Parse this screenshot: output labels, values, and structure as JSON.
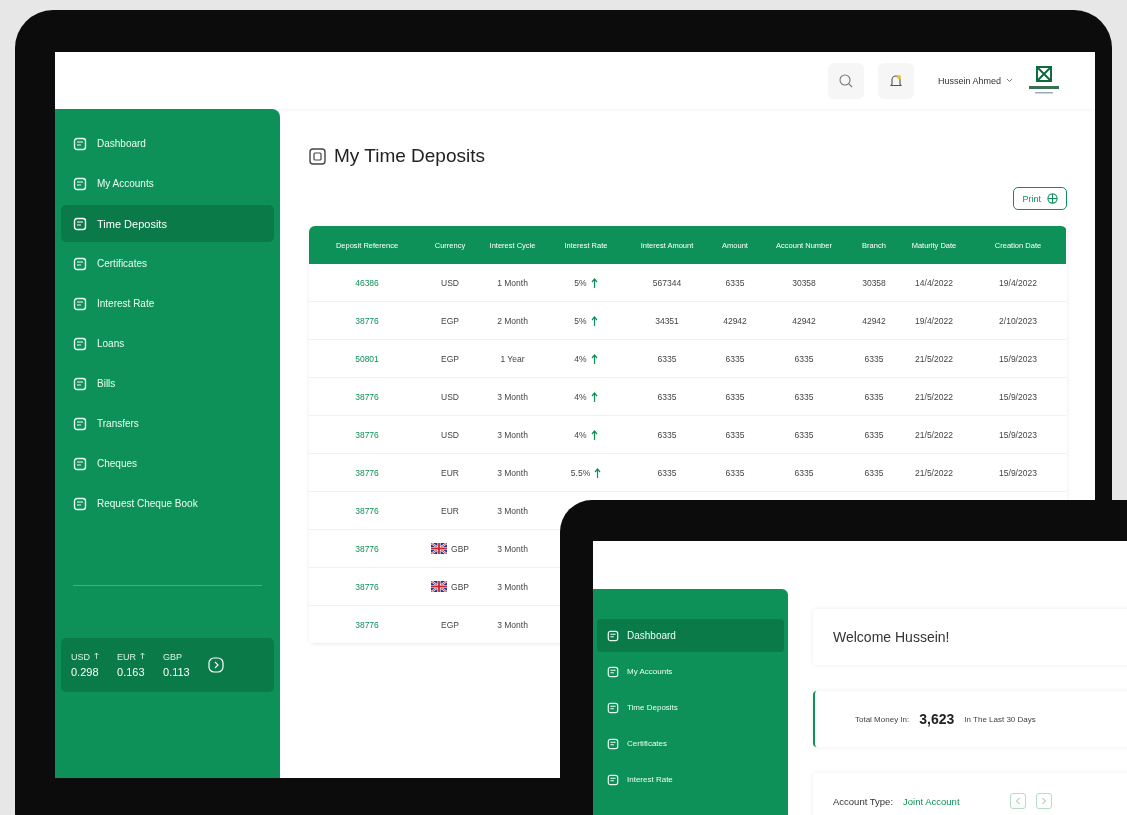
{
  "header": {
    "user_name": "Hussein Ahmed"
  },
  "sidebar": {
    "items": [
      {
        "label": "Dashboard",
        "selected": false
      },
      {
        "label": "My Accounts",
        "selected": false
      },
      {
        "label": "Time Deposits",
        "selected": true
      },
      {
        "label": "Certificates",
        "selected": false
      },
      {
        "label": "Interest Rate",
        "selected": false
      },
      {
        "label": "Loans",
        "selected": false
      },
      {
        "label": "Bills",
        "selected": false
      },
      {
        "label": "Transfers",
        "selected": false
      },
      {
        "label": "Cheques",
        "selected": false
      },
      {
        "label": "Request Cheque Book",
        "selected": false
      }
    ],
    "rates": [
      {
        "currency": "USD",
        "up": true,
        "value": "0.298"
      },
      {
        "currency": "EUR",
        "up": true,
        "value": "0.163"
      },
      {
        "currency": "GBP",
        "up": false,
        "value": "0.113"
      }
    ]
  },
  "page": {
    "title": "My Time Deposits",
    "print_button": "Print"
  },
  "table": {
    "columns": [
      "Deposit Reference",
      "Currency",
      "Interest Cycle",
      "Interest Rate",
      "Interest Amount",
      "Amount",
      "Account Number",
      "Branch",
      "Maturity Date",
      "Creation Date"
    ],
    "rows": [
      {
        "flag": false,
        "cells": [
          "46386",
          "USD",
          "1 Month",
          "5%",
          "567344",
          "6335",
          "30358",
          "30358",
          "14/4/2022",
          "19/4/2022"
        ]
      },
      {
        "flag": false,
        "cells": [
          "38776",
          "EGP",
          "2 Month",
          "5%",
          "34351",
          "42942",
          "42942",
          "42942",
          "19/4/2022",
          "2/10/2023"
        ]
      },
      {
        "flag": false,
        "cells": [
          "50801",
          "EGP",
          "1 Year",
          "4%",
          "6335",
          "6335",
          "6335",
          "6335",
          "21/5/2022",
          "15/9/2023"
        ]
      },
      {
        "flag": false,
        "cells": [
          "38776",
          "USD",
          "3 Month",
          "4%",
          "6335",
          "6335",
          "6335",
          "6335",
          "21/5/2022",
          "15/9/2023"
        ]
      },
      {
        "flag": false,
        "cells": [
          "38776",
          "USD",
          "3 Month",
          "4%",
          "6335",
          "6335",
          "6335",
          "6335",
          "21/5/2022",
          "15/9/2023"
        ]
      },
      {
        "flag": false,
        "cells": [
          "38776",
          "EUR",
          "3 Month",
          "5.5%",
          "6335",
          "6335",
          "6335",
          "6335",
          "21/5/2022",
          "15/9/2023"
        ]
      },
      {
        "flag": false,
        "cells": [
          "38776",
          "EUR",
          "3 Month"
        ]
      },
      {
        "flag": true,
        "cells": [
          "38776",
          "GBP",
          "3 Month"
        ]
      },
      {
        "flag": true,
        "cells": [
          "38776",
          "GBP",
          "3 Month"
        ]
      },
      {
        "flag": false,
        "cells": [
          "38776",
          "EGP",
          "3 Month"
        ]
      }
    ]
  },
  "second_tablet": {
    "sidebar": {
      "items": [
        {
          "label": "Dashboard",
          "selected": true
        },
        {
          "label": "My Accounts",
          "selected": false
        },
        {
          "label": "Time Deposits",
          "selected": false
        },
        {
          "label": "Certificates",
          "selected": false
        },
        {
          "label": "Interest Rate",
          "selected": false
        }
      ]
    },
    "welcome": "Welcome Hussein!",
    "total_money": {
      "label": "Total Money In:",
      "value": "3,623",
      "period": "In The Last 30 Days"
    },
    "account_type": {
      "label": "Account Type:",
      "value": "Joint Account"
    }
  }
}
